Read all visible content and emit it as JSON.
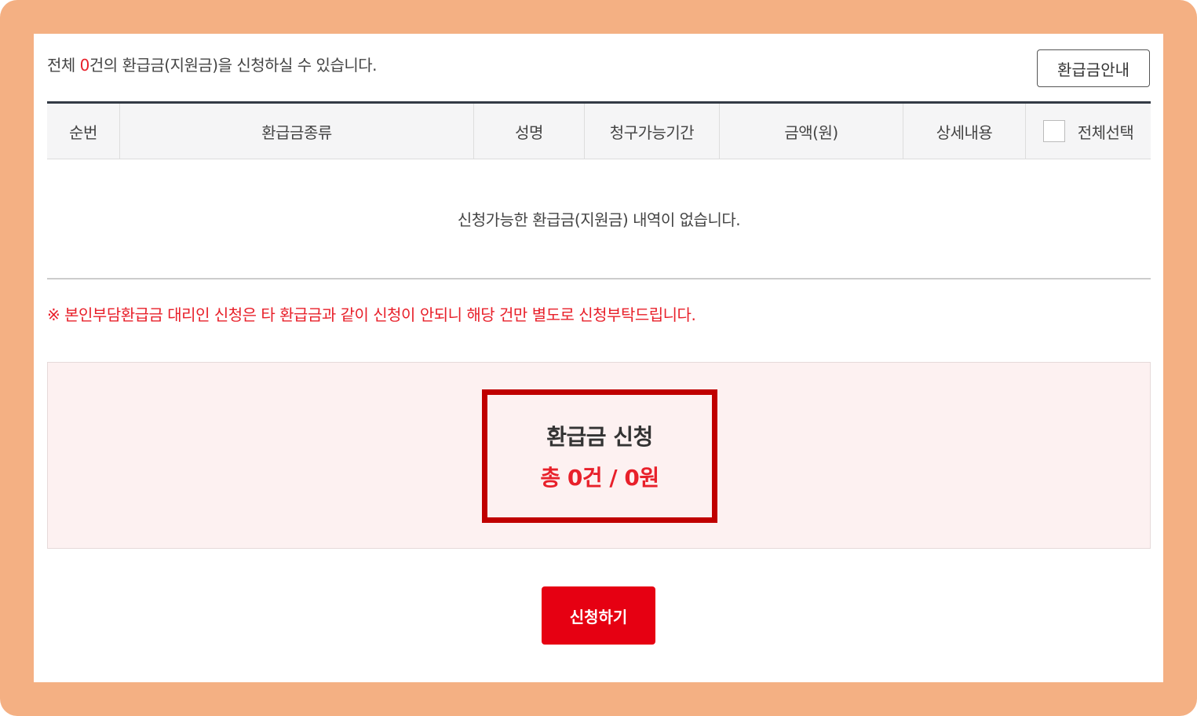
{
  "summary": {
    "prefix": "전체 ",
    "count": "0",
    "suffix": "건의 환급금(지원금)을 신청하실 수 있습니다."
  },
  "guide_button": "환급금안내",
  "table": {
    "headers": [
      "순번",
      "환급금종류",
      "성명",
      "청구가능기간",
      "금액(원)",
      "상세내용",
      "전체선택"
    ],
    "empty_message": "신청가능한 환급금(지원금) 내역이 없습니다."
  },
  "notice": "※ 본인부담환급금 대리인 신청은 타 환급금과 같이 신청이 안되니 해당 건만 별도로 신청부탁드립니다.",
  "apply": {
    "title": "환급금 신청",
    "total": "총 0건 / 0원"
  },
  "submit_button": "신청하기",
  "colors": {
    "frame": "#f4b083",
    "accent_red": "#e8202a",
    "button_red": "#e60012",
    "highlight_border": "#c00000",
    "apply_bg": "#fdf1f1"
  }
}
